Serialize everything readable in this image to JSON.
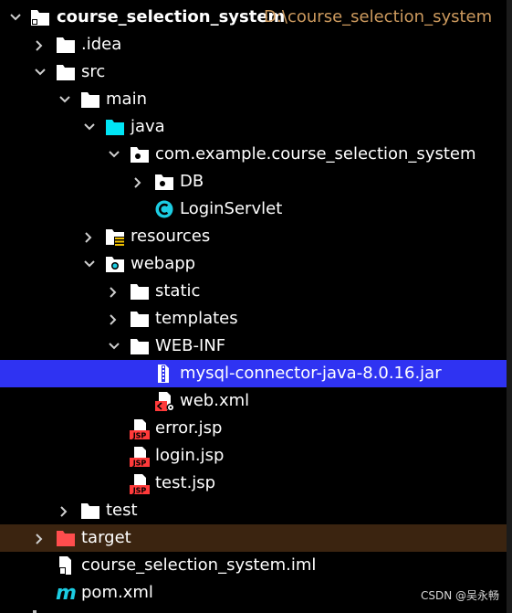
{
  "project": {
    "name": "course_selection_system",
    "path": "D:\\course_selection_system"
  },
  "items": {
    "idea": ".idea",
    "src": "src",
    "main": "main",
    "java": "java",
    "package": "com.example.course_selection_system",
    "db": "DB",
    "login_servlet": "LoginServlet",
    "resources": "resources",
    "webapp": "webapp",
    "static": "static",
    "templates": "templates",
    "web_inf": "WEB-INF",
    "mysql_jar": "mysql-connector-java-8.0.16.jar",
    "web_xml": "web.xml",
    "error_jsp": "error.jsp",
    "login_jsp": "login.jsp",
    "test_jsp": "test.jsp",
    "test": "test",
    "target": "target",
    "iml": "course_selection_system.iml",
    "pom": "pom.xml"
  },
  "badges": {
    "jsp": "JSP",
    "maven": "m"
  },
  "watermark": "CSDN @吴永畅",
  "colors": {
    "selected_row": "#2f33f2",
    "target_row": "#3b2410",
    "path_text": "#cd9a5e",
    "source_folder": "#00e5f5",
    "excluded_folder": "#ff4d4d",
    "jsp_badge": "#ff3a3a",
    "class_icon": "#1ccde3"
  },
  "icons": [
    "folder-icon",
    "source-folder-icon",
    "package-icon",
    "class-icon",
    "resources-folder-icon",
    "web-folder-icon",
    "jar-icon",
    "xml-icon",
    "jsp-icon",
    "iml-icon",
    "maven-icon"
  ]
}
